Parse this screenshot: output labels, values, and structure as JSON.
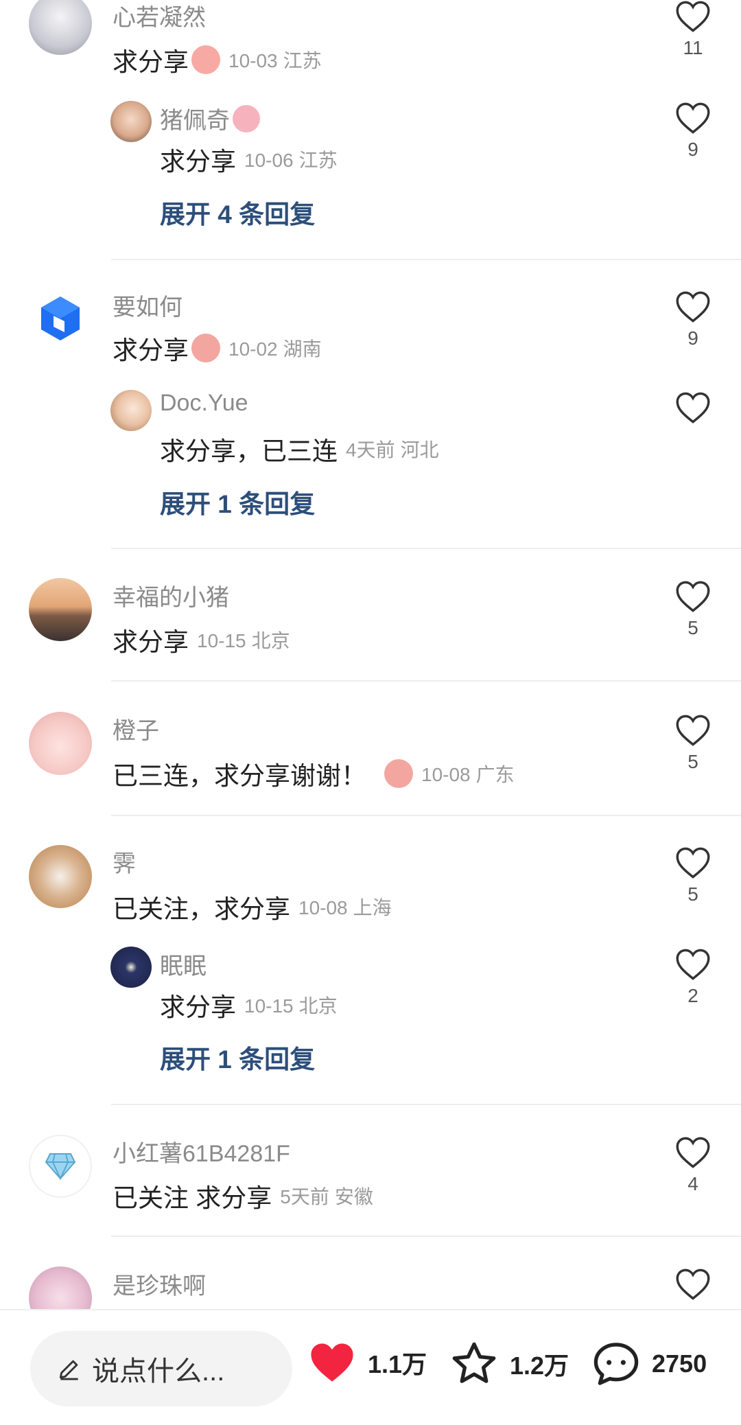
{
  "comments": [
    {
      "user": "心若凝然",
      "text": "求分享",
      "date": "10-03",
      "location": "江苏",
      "likes": "11",
      "reply": {
        "user": "猪佩奇",
        "text": "求分享",
        "date": "10-06",
        "location": "江苏",
        "likes": "9"
      },
      "expand_label": "展开 4 条回复"
    },
    {
      "user": "要如何",
      "text": "求分享",
      "date": "10-02",
      "location": "湖南",
      "likes": "9",
      "reply": {
        "user": "Doc.Yue",
        "text": "求分享，已三连",
        "date": "4天前",
        "location": "河北"
      },
      "expand_label": "展开 1 条回复"
    },
    {
      "user": "幸福的小猪",
      "text": "求分享",
      "date": "10-15",
      "location": "北京",
      "likes": "5"
    },
    {
      "user": "橙子",
      "text": "已三连，求分享谢谢！",
      "date": "10-08",
      "location": "广东",
      "likes": "5"
    },
    {
      "user": "霁",
      "text": "已关注，求分享",
      "date": "10-08",
      "location": "上海",
      "likes": "5",
      "reply": {
        "user": "眠眠",
        "text": "求分享",
        "date": "10-15",
        "location": "北京",
        "likes": "2"
      },
      "expand_label": "展开 1 条回复"
    },
    {
      "user": "小红薯61B4281F",
      "text": "已关注 求分享",
      "date": "5天前",
      "location": "安徽",
      "likes": "4"
    },
    {
      "user": "是珍珠啊"
    }
  ],
  "bottom_bar": {
    "input_placeholder": "说点什么...",
    "like_count": "1.1万",
    "collect_count": "1.2万",
    "comment_count": "2750"
  },
  "colors": {
    "like_red": "#f2243f",
    "link_blue": "#2d4e7a"
  }
}
